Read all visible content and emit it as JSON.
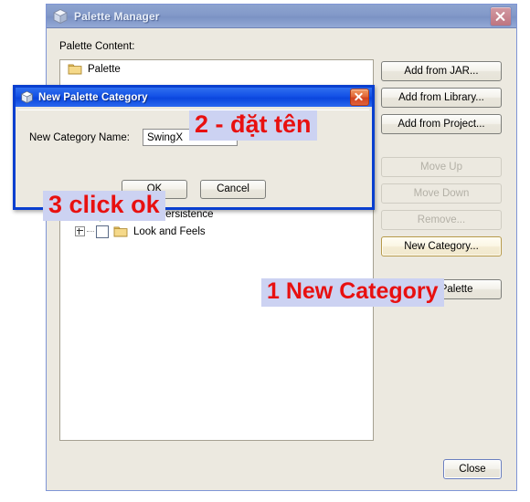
{
  "window": {
    "title": "Palette Manager",
    "icon": "cube-icon",
    "close_icon": "close-icon",
    "content_label": "Palette Content:"
  },
  "tree": {
    "root": {
      "label": "Palette",
      "icon": "folder-icon"
    },
    "items": [
      {
        "label": "",
        "checked": false,
        "expandable": true,
        "partial": true
      },
      {
        "label": "Java Persistence",
        "checked": true,
        "expandable": true
      },
      {
        "label": "Look and Feels",
        "checked": false,
        "expandable": true
      }
    ]
  },
  "buttons": {
    "add_from_jar": "Add from JAR...",
    "add_from_library": "Add from Library...",
    "add_from_project": "Add from Project...",
    "move_up": "Move Up",
    "move_down": "Move Down",
    "remove": "Remove...",
    "new_category": "New Category...",
    "reset_palette": "Reset Palette",
    "close": "Close"
  },
  "dialog": {
    "title": "New Palette Category",
    "icon": "cube-icon",
    "close_icon": "close-icon",
    "name_label": "New Category Name:",
    "name_value": "SwingX",
    "name_placeholder": "",
    "ok": "OK",
    "cancel": "Cancel"
  },
  "annotations": {
    "step1": "1 New Category",
    "step2": "2 - đặt tên",
    "step3": "3 click ok"
  },
  "colors": {
    "annotation_text": "#e81010",
    "annotation_bg": "#ccd2f2",
    "dialog_border": "#0a3fcf",
    "window_bg": "#ece9e0",
    "focus_border": "#b79a4b"
  }
}
